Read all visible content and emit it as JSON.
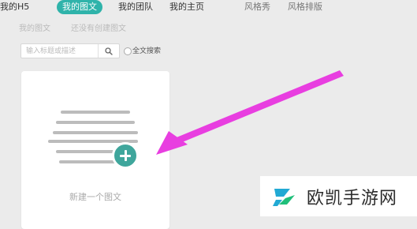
{
  "nav": {
    "tabs": [
      {
        "label": "我的H5"
      },
      {
        "label": "我的图文"
      },
      {
        "label": "我的团队"
      },
      {
        "label": "我的主页"
      },
      {
        "label": "风格秀"
      },
      {
        "label": "风格排版"
      }
    ]
  },
  "sub_nav": {
    "tabs": [
      {
        "label": "我的图文"
      },
      {
        "label": "还没有创建图文"
      }
    ]
  },
  "search": {
    "placeholder": "输入标题或描述",
    "fulltext_label": "全文搜索",
    "icon": "search-icon"
  },
  "card": {
    "label": "新建一个图文",
    "icon": "plus-icon",
    "accent_color": "#3fa69c"
  },
  "annotation": {
    "arrow_color": "#e83ee0"
  },
  "watermark": {
    "text": "欧凯手游网",
    "logo_color": "#21a9d4",
    "logo_color_2": "#1fbf7a"
  },
  "colors": {
    "active_tab": "#2fb3aa",
    "background": "#ebebeb"
  }
}
